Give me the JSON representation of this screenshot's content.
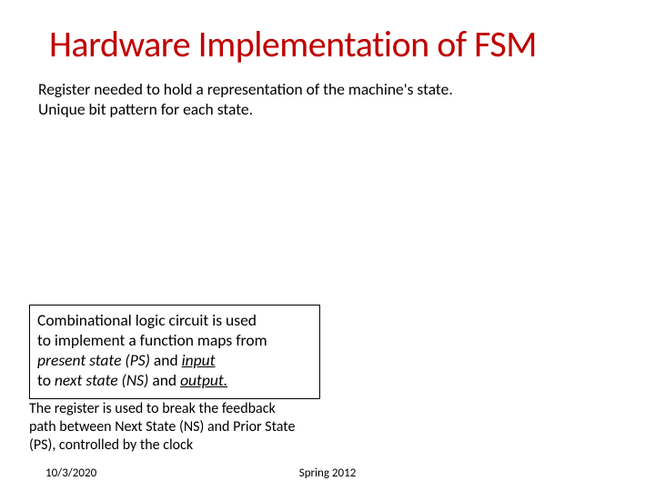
{
  "title": "Hardware Implementation of FSM",
  "intro_l1": "Register needed to hold a representation of the machine's state.",
  "intro_l2": "Unique bit pattern for each state.",
  "box": {
    "l1": "Combinational logic circuit is used",
    "l2": "to implement a function maps from",
    "l3a": "present state (PS)",
    "l3b": " and ",
    "l3c": "input",
    "l4a": "to ",
    "l4b": "next state (NS)",
    "l4c": " and ",
    "l4d": "output."
  },
  "closing_l1": "The register is used to break the feedback",
  "closing_l2": "path between Next State (NS) and Prior State",
  "closing_l3": "(PS), controlled by the clock",
  "footer": {
    "date": "10/3/2020",
    "center": "Spring 2012"
  }
}
